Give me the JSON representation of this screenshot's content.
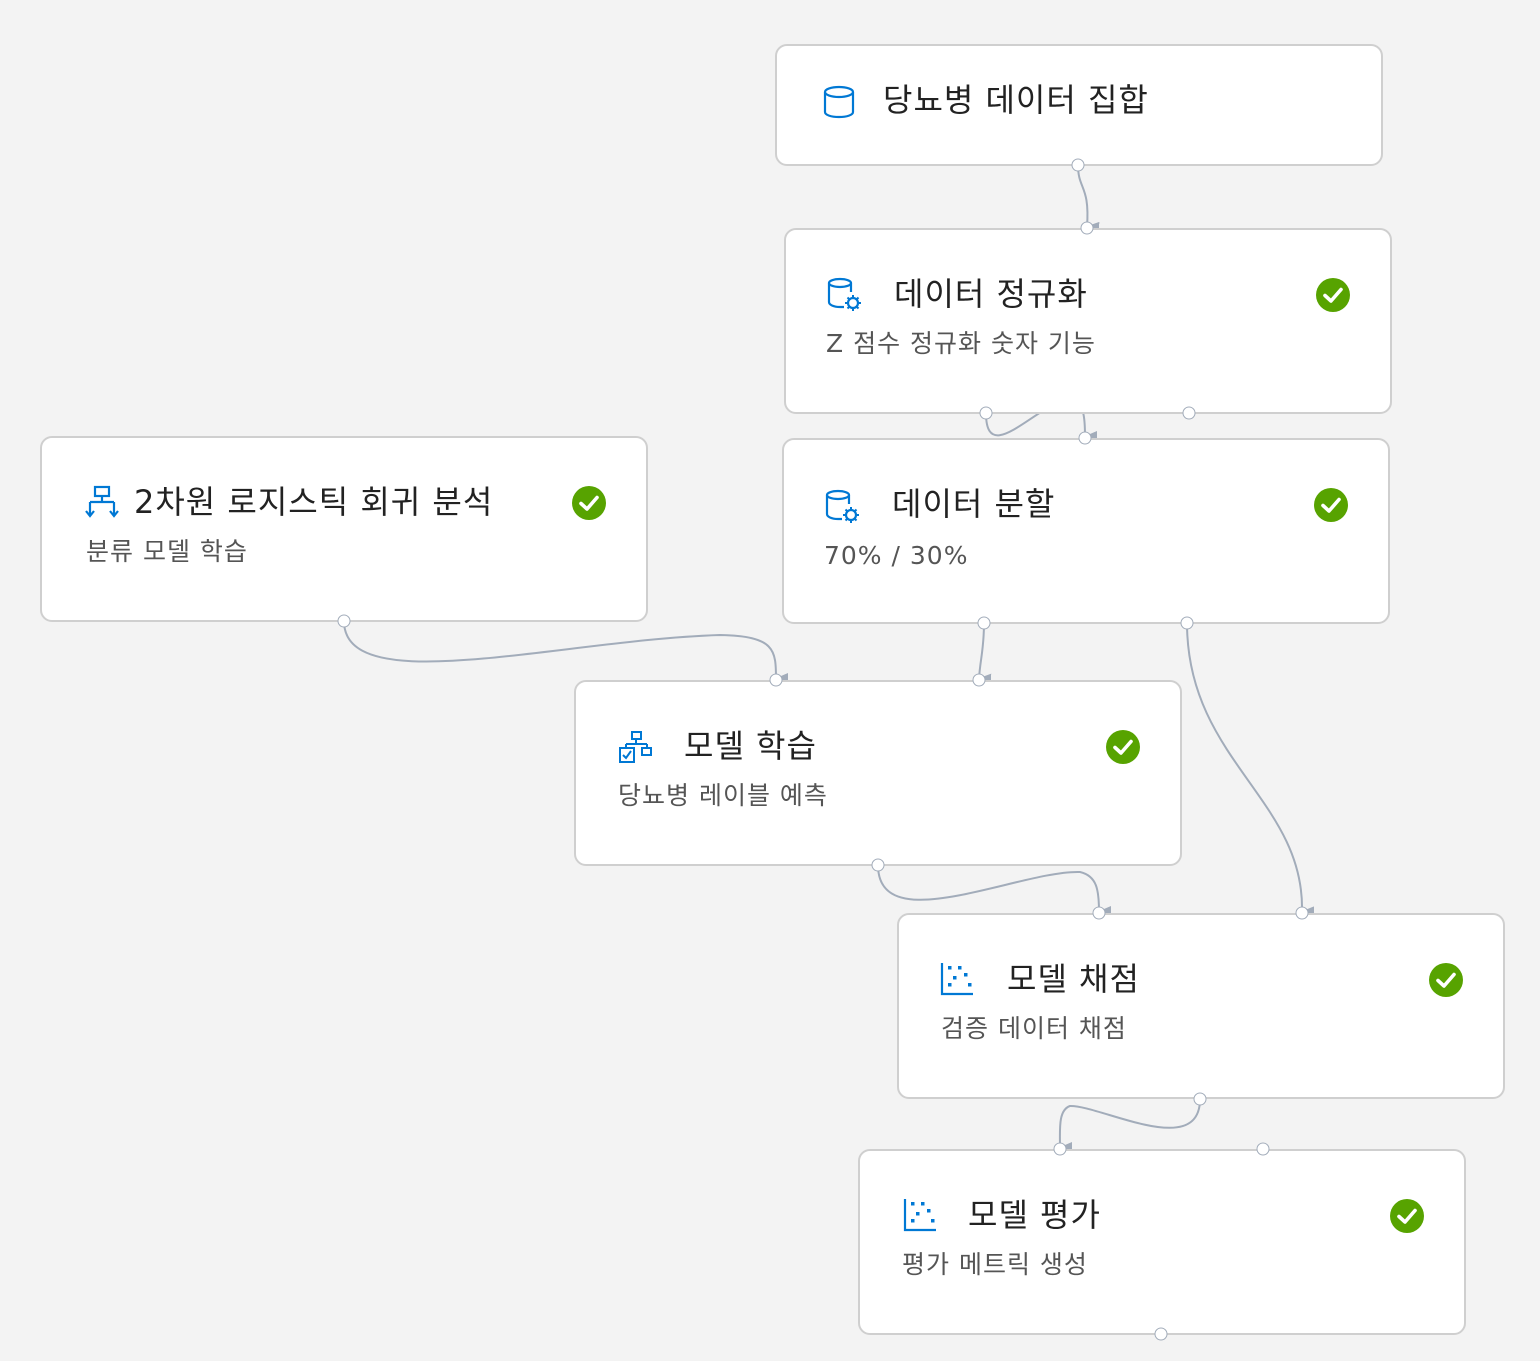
{
  "nodes": {
    "dataset": {
      "title": "당뇨병 데이터 집합",
      "icon": "database-icon"
    },
    "normalize": {
      "title": "데이터 정규화",
      "subtitle": "Z 점수 정규화 숫자 기능",
      "icon": "data-transform-icon",
      "status": "completed"
    },
    "logistic": {
      "title": "2차원 로지스틱 회귀 분석",
      "subtitle": "분류 모델 학습",
      "icon": "algorithm-tree-icon",
      "status": "completed"
    },
    "split": {
      "title": "데이터 분할",
      "subtitle": "70% / 30%",
      "icon": "data-transform-icon",
      "status": "completed"
    },
    "train": {
      "title": "모델 학습",
      "subtitle": "당뇨병 레이블 예측",
      "icon": "train-model-icon",
      "status": "completed"
    },
    "score": {
      "title": "모델 채점",
      "subtitle": "검증 데이터 채점",
      "icon": "scatter-chart-icon",
      "status": "completed"
    },
    "evaluate": {
      "title": "모델 평가",
      "subtitle": "평가 메트릭 생성",
      "icon": "scatter-chart-icon",
      "status": "completed"
    }
  },
  "colors": {
    "canvas": "#f3f3f3",
    "node_border": "#cfcfcf",
    "icon_blue": "#0078d4",
    "status_green": "#57a300",
    "wire": "#a2acba"
  },
  "connections": [
    {
      "from": "dataset",
      "to": "normalize"
    },
    {
      "from": "normalize",
      "to": "split"
    },
    {
      "from": "logistic",
      "to": "train"
    },
    {
      "from": "split",
      "to": "train"
    },
    {
      "from": "split",
      "to": "score"
    },
    {
      "from": "train",
      "to": "score"
    },
    {
      "from": "score",
      "to": "evaluate"
    }
  ]
}
